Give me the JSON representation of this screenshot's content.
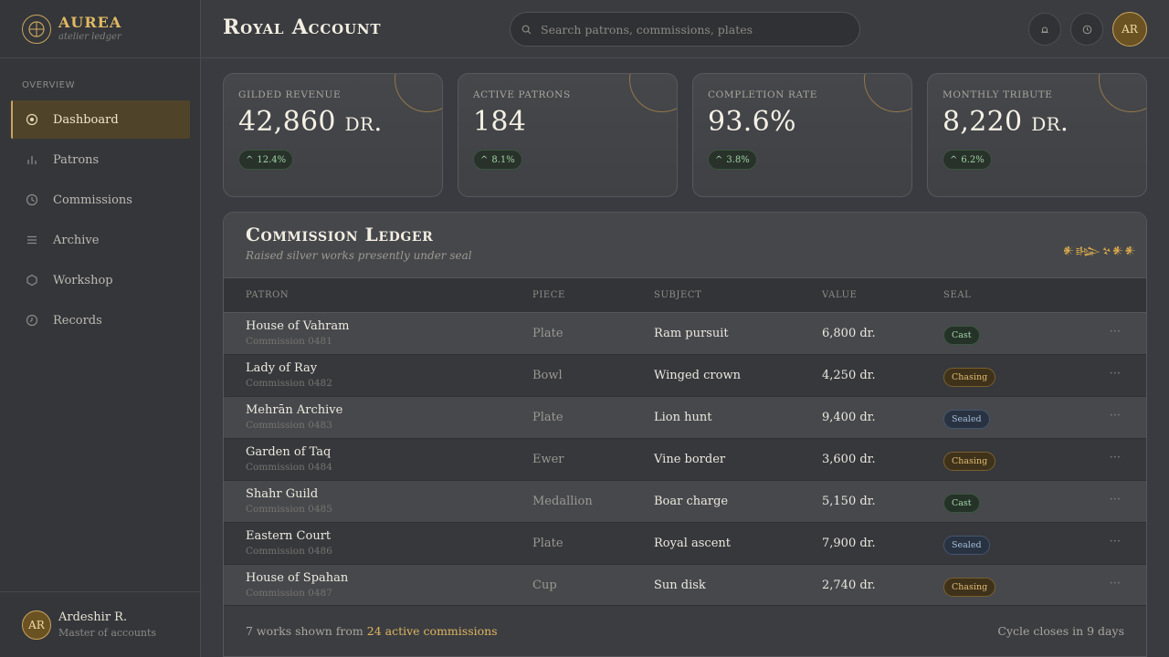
{
  "brand": {
    "name": "AUREA",
    "tagline": "atelier ledger"
  },
  "sidebar": {
    "heading": "Overview",
    "items": [
      {
        "label": "Dashboard",
        "icon": "target-icon",
        "active": true
      },
      {
        "label": "Patrons",
        "icon": "bar-chart-icon",
        "active": false
      },
      {
        "label": "Commissions",
        "icon": "clock-icon",
        "active": false
      },
      {
        "label": "Archive",
        "icon": "list-icon",
        "active": false
      },
      {
        "label": "Workshop",
        "icon": "hexagon-icon",
        "active": false
      },
      {
        "label": "Records",
        "icon": "history-icon",
        "active": false
      }
    ]
  },
  "user": {
    "initials": "AR",
    "name": "Ardeshir R.",
    "role": "Master of accounts"
  },
  "header": {
    "title": "Royal Account",
    "search_placeholder": "Search patrons, commissions, plates",
    "avatar_initials": "AR"
  },
  "stats": [
    {
      "label": "Gilded Revenue",
      "number": "42,860",
      "unit": "dr.",
      "trend": "12.4%"
    },
    {
      "label": "Active Patrons",
      "number": "184",
      "unit": "",
      "trend": "8.1%"
    },
    {
      "label": "Completion Rate",
      "number": "93.6%",
      "unit": "",
      "trend": "3.8%"
    },
    {
      "label": "Monthly Tribute",
      "number": "8,220",
      "unit": "dr.",
      "trend": "6.2%"
    }
  ],
  "ledger": {
    "title": "Commission Ledger",
    "subtitle": "Raised silver works presently under seal",
    "glyphs": "𒀭𒈗𒆳𒀭𒀭",
    "columns": {
      "patron": "Patron",
      "piece": "Piece",
      "subject": "Subject",
      "value": "Value",
      "seal": "Seal"
    },
    "rows": [
      {
        "patron": "House of Vahram",
        "commission": "Commission 0481",
        "piece": "Plate",
        "subject": "Ram pursuit",
        "value": "6,800 dr.",
        "seal": "Cast"
      },
      {
        "patron": "Lady of Ray",
        "commission": "Commission 0482",
        "piece": "Bowl",
        "subject": "Winged crown",
        "value": "4,250 dr.",
        "seal": "Chasing"
      },
      {
        "patron": "Mehrān Archive",
        "commission": "Commission 0483",
        "piece": "Plate",
        "subject": "Lion hunt",
        "value": "9,400 dr.",
        "seal": "Sealed"
      },
      {
        "patron": "Garden of Taq",
        "commission": "Commission 0484",
        "piece": "Ewer",
        "subject": "Vine border",
        "value": "3,600 dr.",
        "seal": "Chasing"
      },
      {
        "patron": "Shahr Guild",
        "commission": "Commission 0485",
        "piece": "Medallion",
        "subject": "Boar charge",
        "value": "5,150 dr.",
        "seal": "Cast"
      },
      {
        "patron": "Eastern Court",
        "commission": "Commission 0486",
        "piece": "Plate",
        "subject": "Royal ascent",
        "value": "7,900 dr.",
        "seal": "Sealed"
      },
      {
        "patron": "House of Spahan",
        "commission": "Commission 0487",
        "piece": "Cup",
        "subject": "Sun disk",
        "value": "2,740 dr.",
        "seal": "Chasing"
      }
    ],
    "more_glyph": "···",
    "footer_prefix": "7 works shown from ",
    "footer_link": "24 active commissions",
    "footer_right": "Cycle closes in 9 days"
  },
  "seal_colors": {
    "Cast": {
      "bg": "#243227",
      "border": "#3c5641",
      "text": "#a9d5ad"
    },
    "Chasing": {
      "bg": "#3f321b",
      "border": "#7a5f2c",
      "text": "#e2bd72"
    },
    "Sealed": {
      "bg": "#283240",
      "border": "#455672",
      "text": "#a9bedc"
    }
  }
}
